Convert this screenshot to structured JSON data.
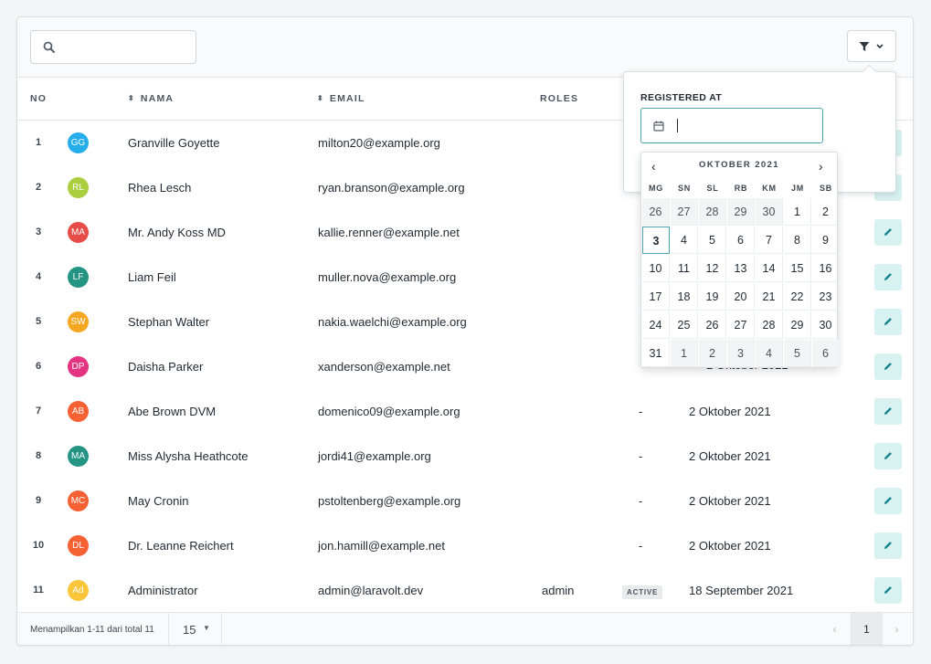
{
  "search": {
    "placeholder": ""
  },
  "table": {
    "columns": {
      "no": "NO",
      "name": "NAMA",
      "email": "EMAIL",
      "roles": "ROLES"
    },
    "rows": [
      {
        "no": "1",
        "initials": "GG",
        "avatar_color": "#0ea5e9",
        "name": "Granville Goyette",
        "email": "milton20@example.org",
        "roles": "",
        "status": "",
        "date": ""
      },
      {
        "no": "2",
        "initials": "RL",
        "avatar_color": "#a3c92b",
        "name": "Rhea Lesch",
        "email": "ryan.branson@example.org",
        "roles": "",
        "status": "",
        "date": ""
      },
      {
        "no": "3",
        "initials": "MA",
        "avatar_color": "#e53935",
        "name": "Mr. Andy Koss MD",
        "email": "kallie.renner@example.net",
        "roles": "",
        "status": "",
        "date": ""
      },
      {
        "no": "4",
        "initials": "LF",
        "avatar_color": "#0d8a78",
        "name": "Liam Feil",
        "email": "muller.nova@example.org",
        "roles": "",
        "status": "",
        "date": ""
      },
      {
        "no": "5",
        "initials": "SW",
        "avatar_color": "#f59e0b",
        "name": "Stephan Walter",
        "email": "nakia.waelchi@example.org",
        "roles": "",
        "status": "",
        "date": ""
      },
      {
        "no": "6",
        "initials": "DP",
        "avatar_color": "#e11d74",
        "name": "Daisha Parker",
        "email": "xanderson@example.net",
        "roles": "",
        "status": "",
        "date": ""
      },
      {
        "no": "7",
        "initials": "AB",
        "avatar_color": "#f4511e",
        "name": "Abe Brown DVM",
        "email": "domenico09@example.org",
        "roles": "",
        "status": "-",
        "date": "2 Oktober 2021"
      },
      {
        "no": "8",
        "initials": "MA",
        "avatar_color": "#0d8a78",
        "name": "Miss Alysha Heathcote",
        "email": "jordi41@example.org",
        "roles": "",
        "status": "-",
        "date": "2 Oktober 2021"
      },
      {
        "no": "9",
        "initials": "MC",
        "avatar_color": "#f4511e",
        "name": "May Cronin",
        "email": "pstoltenberg@example.org",
        "roles": "",
        "status": "-",
        "date": "2 Oktober 2021"
      },
      {
        "no": "10",
        "initials": "DL",
        "avatar_color": "#f4511e",
        "name": "Dr. Leanne Reichert",
        "email": "jon.hamill@example.net",
        "roles": "",
        "status": "-",
        "date": "2 Oktober 2021"
      },
      {
        "no": "11",
        "initials": "Ad",
        "avatar_color": "#fbbf24",
        "name": "Administrator",
        "email": "admin@laravolt.dev",
        "roles": "admin",
        "status": "ACTIVE",
        "date": "18 September 2021"
      }
    ]
  },
  "footer": {
    "summary": "Menampilkan 1-11 dari total 11",
    "per_page": "15",
    "current_page": "1"
  },
  "filter": {
    "label": "REGISTERED AT",
    "date_value": "",
    "calendar": {
      "month": "OKTOBER 2021",
      "weekdays": [
        "MG",
        "SN",
        "SL",
        "RB",
        "KM",
        "JM",
        "SB"
      ],
      "weeks": [
        [
          "26",
          "27",
          "28",
          "29",
          "30",
          "1",
          "2"
        ],
        [
          "3",
          "4",
          "5",
          "6",
          "7",
          "8",
          "9"
        ],
        [
          "10",
          "11",
          "12",
          "13",
          "14",
          "15",
          "16"
        ],
        [
          "17",
          "18",
          "19",
          "20",
          "21",
          "22",
          "23"
        ],
        [
          "24",
          "25",
          "26",
          "27",
          "28",
          "29",
          "30"
        ],
        [
          "31",
          "1",
          "2",
          "3",
          "4",
          "5",
          "6"
        ]
      ],
      "today": "3"
    }
  },
  "partial_texts": {
    "row6_date_fragment": "2 Oktober 2021"
  },
  "colors": {
    "accent": "#4fa3b0",
    "edit_button_bg": "#d8f1f1",
    "edit_icon": "#14828a"
  }
}
